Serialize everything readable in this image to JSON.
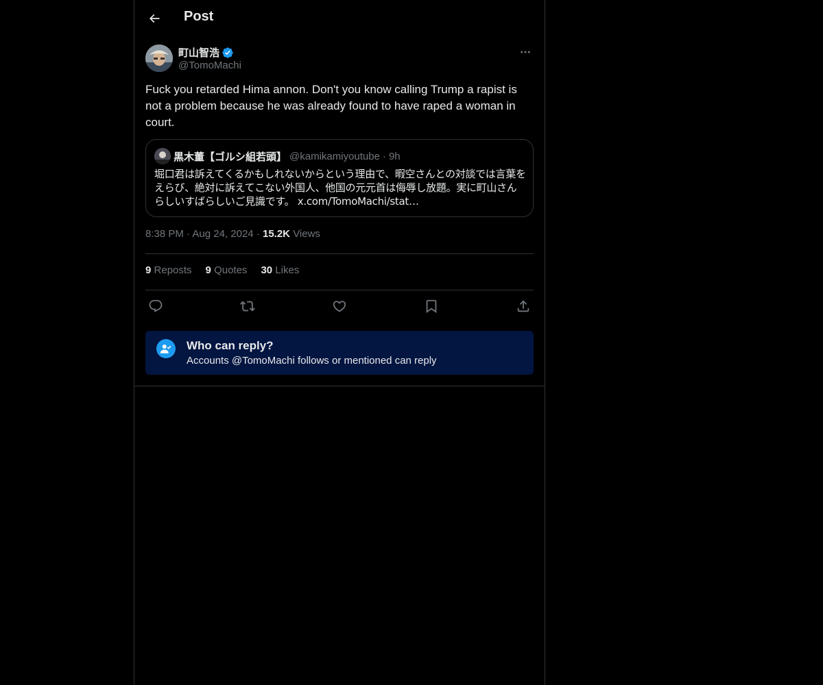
{
  "header": {
    "title": "Post"
  },
  "post": {
    "author_name": "町山智浩",
    "author_handle": "@TomoMachi",
    "text": "Fuck you retarded Hima annon. Don't you know calling Trump a rapist is not a problem because he was already found to have raped a woman in court.",
    "quote": {
      "name": "黒木董【ゴルシ組若頭】",
      "handle": "@kamikamiyoutube",
      "time": "9h",
      "text": "堀口君は訴えてくるかもしれないからという理由で、暇空さんとの対談では言葉をえらび、絶対に訴えてこない外国人、他国の元元首は侮辱し放題。実に町山さんらしいすばらしいご見識です。 x.com/TomoMachi/stat…"
    },
    "time": "8:38 PM",
    "date": "Aug 24, 2024",
    "views_count": "15.2K",
    "views_label": "Views",
    "stats": {
      "reposts_count": "9",
      "reposts_label": "Reposts",
      "quotes_count": "9",
      "quotes_label": "Quotes",
      "likes_count": "30",
      "likes_label": "Likes"
    }
  },
  "reply_restriction": {
    "title": "Who can reply?",
    "subtitle": "Accounts @TomoMachi follows or mentioned can reply"
  },
  "colors": {
    "background": "#000000",
    "text": "#e7e9ea",
    "muted": "#71767b",
    "accent": "#1d9bf0",
    "border": "#2f3336",
    "notice_bg": "#031541"
  },
  "icons": [
    "back-arrow-icon",
    "verified-badge-icon",
    "more-icon",
    "reply-icon",
    "repost-icon",
    "like-icon",
    "bookmark-icon",
    "share-icon",
    "mention-user-icon"
  ]
}
